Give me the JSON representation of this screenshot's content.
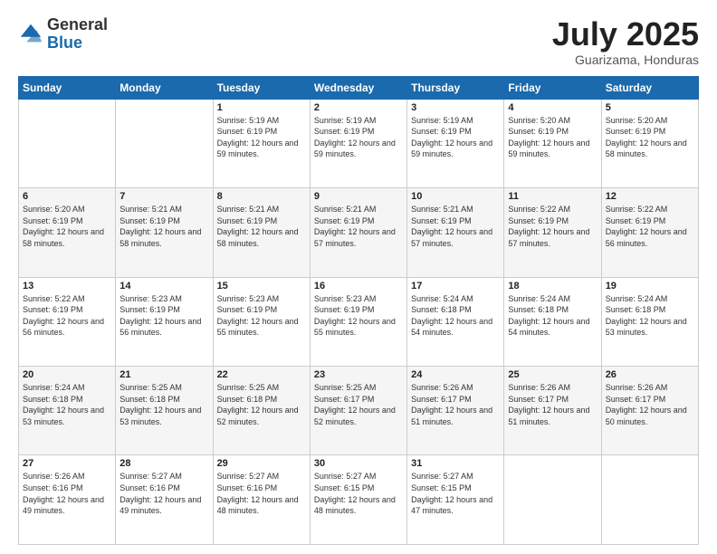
{
  "header": {
    "logo": {
      "general": "General",
      "blue": "Blue"
    },
    "title": "July 2025",
    "location": "Guarizama, Honduras"
  },
  "days_of_week": [
    "Sunday",
    "Monday",
    "Tuesday",
    "Wednesday",
    "Thursday",
    "Friday",
    "Saturday"
  ],
  "weeks": [
    [
      {
        "day": "",
        "info": ""
      },
      {
        "day": "",
        "info": ""
      },
      {
        "day": "1",
        "info": "Sunrise: 5:19 AM\nSunset: 6:19 PM\nDaylight: 12 hours and 59 minutes."
      },
      {
        "day": "2",
        "info": "Sunrise: 5:19 AM\nSunset: 6:19 PM\nDaylight: 12 hours and 59 minutes."
      },
      {
        "day": "3",
        "info": "Sunrise: 5:19 AM\nSunset: 6:19 PM\nDaylight: 12 hours and 59 minutes."
      },
      {
        "day": "4",
        "info": "Sunrise: 5:20 AM\nSunset: 6:19 PM\nDaylight: 12 hours and 59 minutes."
      },
      {
        "day": "5",
        "info": "Sunrise: 5:20 AM\nSunset: 6:19 PM\nDaylight: 12 hours and 58 minutes."
      }
    ],
    [
      {
        "day": "6",
        "info": "Sunrise: 5:20 AM\nSunset: 6:19 PM\nDaylight: 12 hours and 58 minutes."
      },
      {
        "day": "7",
        "info": "Sunrise: 5:21 AM\nSunset: 6:19 PM\nDaylight: 12 hours and 58 minutes."
      },
      {
        "day": "8",
        "info": "Sunrise: 5:21 AM\nSunset: 6:19 PM\nDaylight: 12 hours and 58 minutes."
      },
      {
        "day": "9",
        "info": "Sunrise: 5:21 AM\nSunset: 6:19 PM\nDaylight: 12 hours and 57 minutes."
      },
      {
        "day": "10",
        "info": "Sunrise: 5:21 AM\nSunset: 6:19 PM\nDaylight: 12 hours and 57 minutes."
      },
      {
        "day": "11",
        "info": "Sunrise: 5:22 AM\nSunset: 6:19 PM\nDaylight: 12 hours and 57 minutes."
      },
      {
        "day": "12",
        "info": "Sunrise: 5:22 AM\nSunset: 6:19 PM\nDaylight: 12 hours and 56 minutes."
      }
    ],
    [
      {
        "day": "13",
        "info": "Sunrise: 5:22 AM\nSunset: 6:19 PM\nDaylight: 12 hours and 56 minutes."
      },
      {
        "day": "14",
        "info": "Sunrise: 5:23 AM\nSunset: 6:19 PM\nDaylight: 12 hours and 56 minutes."
      },
      {
        "day": "15",
        "info": "Sunrise: 5:23 AM\nSunset: 6:19 PM\nDaylight: 12 hours and 55 minutes."
      },
      {
        "day": "16",
        "info": "Sunrise: 5:23 AM\nSunset: 6:19 PM\nDaylight: 12 hours and 55 minutes."
      },
      {
        "day": "17",
        "info": "Sunrise: 5:24 AM\nSunset: 6:18 PM\nDaylight: 12 hours and 54 minutes."
      },
      {
        "day": "18",
        "info": "Sunrise: 5:24 AM\nSunset: 6:18 PM\nDaylight: 12 hours and 54 minutes."
      },
      {
        "day": "19",
        "info": "Sunrise: 5:24 AM\nSunset: 6:18 PM\nDaylight: 12 hours and 53 minutes."
      }
    ],
    [
      {
        "day": "20",
        "info": "Sunrise: 5:24 AM\nSunset: 6:18 PM\nDaylight: 12 hours and 53 minutes."
      },
      {
        "day": "21",
        "info": "Sunrise: 5:25 AM\nSunset: 6:18 PM\nDaylight: 12 hours and 53 minutes."
      },
      {
        "day": "22",
        "info": "Sunrise: 5:25 AM\nSunset: 6:18 PM\nDaylight: 12 hours and 52 minutes."
      },
      {
        "day": "23",
        "info": "Sunrise: 5:25 AM\nSunset: 6:17 PM\nDaylight: 12 hours and 52 minutes."
      },
      {
        "day": "24",
        "info": "Sunrise: 5:26 AM\nSunset: 6:17 PM\nDaylight: 12 hours and 51 minutes."
      },
      {
        "day": "25",
        "info": "Sunrise: 5:26 AM\nSunset: 6:17 PM\nDaylight: 12 hours and 51 minutes."
      },
      {
        "day": "26",
        "info": "Sunrise: 5:26 AM\nSunset: 6:17 PM\nDaylight: 12 hours and 50 minutes."
      }
    ],
    [
      {
        "day": "27",
        "info": "Sunrise: 5:26 AM\nSunset: 6:16 PM\nDaylight: 12 hours and 49 minutes."
      },
      {
        "day": "28",
        "info": "Sunrise: 5:27 AM\nSunset: 6:16 PM\nDaylight: 12 hours and 49 minutes."
      },
      {
        "day": "29",
        "info": "Sunrise: 5:27 AM\nSunset: 6:16 PM\nDaylight: 12 hours and 48 minutes."
      },
      {
        "day": "30",
        "info": "Sunrise: 5:27 AM\nSunset: 6:15 PM\nDaylight: 12 hours and 48 minutes."
      },
      {
        "day": "31",
        "info": "Sunrise: 5:27 AM\nSunset: 6:15 PM\nDaylight: 12 hours and 47 minutes."
      },
      {
        "day": "",
        "info": ""
      },
      {
        "day": "",
        "info": ""
      }
    ]
  ]
}
